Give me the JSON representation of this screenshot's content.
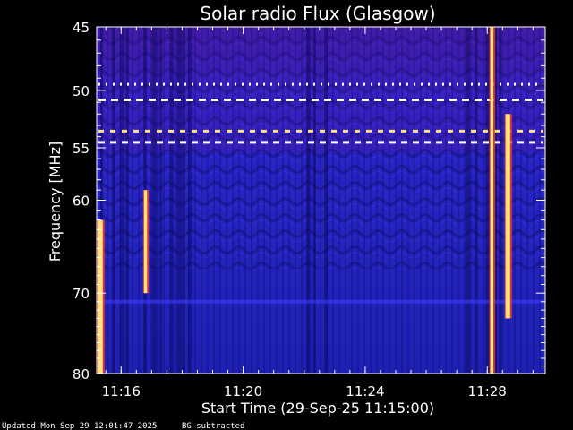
{
  "chart_data": {
    "type": "heatmap",
    "title": "Solar radio Flux (Glasgow)",
    "xlabel": "Start Time (29-Sep-25 11:15:00)",
    "ylabel": "Frequency [MHz]",
    "x_ticks": [
      "11:16",
      "11:20",
      "11:24",
      "11:28"
    ],
    "x_tick_minutes": [
      16,
      20,
      24,
      28
    ],
    "xlim_minutes": [
      15.2,
      29.9
    ],
    "y_ticks": [
      45,
      50,
      55,
      60,
      70,
      80
    ],
    "ylim": [
      45,
      80
    ],
    "yscale": "log",
    "colors": {
      "background": "#000000",
      "spectrogram_base": "#2a1fc4",
      "spectrogram_dark": "#140a78",
      "burst": "#ffe27a",
      "hot": "#ff3a1a",
      "interference": "#ffffff"
    },
    "bursts": [
      {
        "start_minute": 15.25,
        "end_minute": 15.4,
        "freq_min": 62,
        "freq_max": 80
      },
      {
        "start_minute": 16.75,
        "end_minute": 16.85,
        "freq_min": 59,
        "freq_max": 70
      },
      {
        "start_minute": 28.6,
        "end_minute": 28.75,
        "freq_min": 52,
        "freq_max": 73
      },
      {
        "start_minute": 28.1,
        "end_minute": 28.2,
        "freq_min": 45,
        "freq_max": 80
      }
    ],
    "interference_lines": [
      49.5,
      50.8,
      53.5,
      54.5
    ]
  },
  "footer": {
    "updated": "Updated Mon Sep 29 12:01:47 2025",
    "note": "BG subtracted"
  }
}
